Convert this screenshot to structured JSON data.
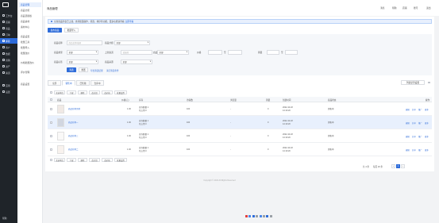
{
  "sidebar": {
    "items": [
      {
        "label": "工作台"
      },
      {
        "label": "店铺"
      },
      {
        "label": "商品"
      },
      {
        "label": "订单"
      },
      {
        "label": "库存"
      },
      {
        "label": "客户"
      },
      {
        "label": "数据"
      },
      {
        "label": "营销"
      },
      {
        "label": "资产"
      },
      {
        "label": "渠道"
      },
      {
        "label": "应用"
      },
      {
        "label": "设置"
      }
    ],
    "footer": "帮助"
  },
  "subnav": {
    "items": [
      {
        "label": "商品管理"
      },
      {
        "label": "商品分组"
      },
      {
        "label": "商品页模板"
      },
      {
        "label": "商品素材"
      },
      {
        "label": "素材中心"
      },
      {
        "label": "商品设置"
      },
      {
        "label": "批量工具"
      },
      {
        "label": "批量导入"
      },
      {
        "label": "批量改价"
      },
      {
        "label": "价格批量改价"
      },
      {
        "label": "评价管理"
      },
      {
        "label": "商品设置"
      }
    ]
  },
  "header": {
    "title": "商品管理",
    "links": [
      "消息",
      "帮助",
      "店铺",
      "账号",
      "退出"
    ]
  },
  "notice": {
    "text": "全新商品列表已上线，支持批量操作、筛选、排序等功能，更多功能请查看",
    "link": "立即查看"
  },
  "actions": {
    "publish": "发布商品",
    "import": "批量导入"
  },
  "filters": {
    "keyword_label": "商品名称",
    "keyword_placeholder": "商品名称/编码",
    "group_label": "商品分组",
    "group_value": "全部",
    "type_label": "商品类型",
    "type_value": "全部",
    "channel_label": "上架渠道",
    "channel_placeholder": "请选择",
    "status_label": "商品状态",
    "status_value": "全部",
    "price_label": "价格",
    "sales_label": "销量",
    "tag_label": "商品标签",
    "tag_value": "全部",
    "source_label": "商品来源",
    "source_value": "全部",
    "to": "至",
    "filter_btn": "筛选",
    "reset_btn": "重置",
    "export_link": "导出筛选结果",
    "clear_link": "清空筛选条件"
  },
  "tabs": [
    "全部",
    "销售中",
    "已售罄",
    "仓库中"
  ],
  "bulk_actions": [
    "全选本页",
    "下架",
    "删除",
    "改分组",
    "改价格",
    "批量设置"
  ],
  "tools": {
    "setting": "列表显示设置"
  },
  "table": {
    "headers": [
      "商品",
      "价格(元)",
      "库存",
      "访客数",
      "浏览量",
      "销量",
      "创建时间",
      "商品状态",
      "操作"
    ],
    "rows": [
      {
        "name": "商品名称示例",
        "price": "1.00",
        "stock_a": "库存数量 1",
        "stock_b": "已占用 0",
        "visitors": "100",
        "views": "-",
        "sales": "0",
        "date": "2022-10-18",
        "time": "14:10:20",
        "status": "销售中",
        "ops": [
          "编辑",
          "分享",
          "推广",
          "更多"
        ]
      },
      {
        "name": "商品名称一",
        "price": "1.00",
        "stock_a": "库存数量 1",
        "stock_b": "已占用 0",
        "visitors": "100",
        "views": "-",
        "sales": "0",
        "date": "2022-10-18",
        "time": "14:10:20",
        "status": "销售中",
        "ops": [
          "编辑",
          "分享",
          "推广",
          "更多"
        ]
      },
      {
        "name": "商品名称三",
        "price": "1.00",
        "stock_a": "库存数量 1",
        "stock_b": "已占用 0",
        "visitors": "100",
        "views": "-",
        "sales": "0",
        "date": "2022-10-18",
        "time": "14:10:20",
        "status": "销售中",
        "ops": [
          "编辑",
          "分享",
          "推广",
          "更多"
        ]
      },
      {
        "name": "商品名称二",
        "price": "1.00",
        "stock_a": "库存数量 1",
        "stock_b": "已占用 0",
        "visitors": "100",
        "views": "-",
        "sales": "0",
        "date": "2022-10-18",
        "time": "14:10:20",
        "status": "销售中",
        "ops": [
          "编辑",
          "分享",
          "推广",
          "更多"
        ]
      }
    ]
  },
  "pagination": {
    "total": "共 4 条",
    "per_page": "每页 20 条",
    "current": "1"
  },
  "footer": {
    "copyright": "Copyright © 2022 All Rights Reserved"
  },
  "colors": {
    "primary": "#2d6bd9",
    "sidebar_bg": "#1f2429"
  }
}
